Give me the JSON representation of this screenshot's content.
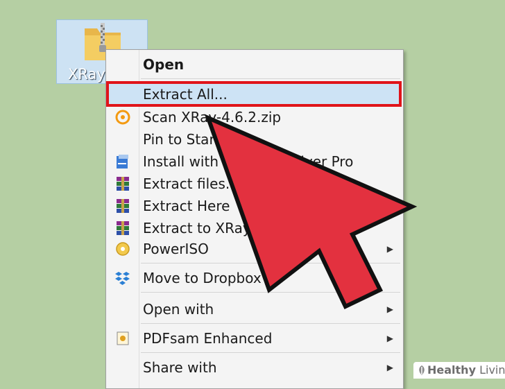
{
  "file": {
    "label": "XRay-",
    "icon": "zip-folder-icon"
  },
  "menu": {
    "items": [
      {
        "label": "Open",
        "icon": "none",
        "bold": true,
        "submenu": false
      },
      {
        "label": "Extract All...",
        "icon": "none",
        "bold": false,
        "submenu": false,
        "highlighted": true
      },
      {
        "label": "Scan XRay-4.6.2.zip",
        "icon": "antivirus-icon",
        "bold": false,
        "submenu": false
      },
      {
        "label": "Pin to Start",
        "icon": "none",
        "bold": false,
        "submenu": false
      },
      {
        "label": "Install with Power Archiver Pro",
        "icon": "installer-icon",
        "bold": false,
        "submenu": false
      },
      {
        "label": "Extract files...",
        "icon": "winrar-icon",
        "bold": false,
        "submenu": false
      },
      {
        "label": "Extract Here",
        "icon": "winrar-icon",
        "bold": false,
        "submenu": false
      },
      {
        "label": "Extract to XRay",
        "icon": "winrar-icon",
        "bold": false,
        "submenu": false
      },
      {
        "label": "PowerISO",
        "icon": "poweriso-icon",
        "bold": false,
        "submenu": true
      },
      {
        "label": "Move to Dropbox",
        "icon": "dropbox-icon",
        "bold": false,
        "submenu": false
      },
      {
        "label": "Open with",
        "icon": "none",
        "bold": false,
        "submenu": true
      },
      {
        "label": "PDFsam Enhanced",
        "icon": "pdfsam-icon",
        "bold": false,
        "submenu": true
      },
      {
        "label": "Share with",
        "icon": "none",
        "bold": false,
        "submenu": true
      }
    ]
  },
  "watermark": {
    "brand_part1": "Healthy",
    "brand_part2": " Living"
  },
  "colors": {
    "desktop": "#b5cfa3",
    "highlight_border": "#e0141a",
    "pointer_fill": "#e3313f"
  }
}
